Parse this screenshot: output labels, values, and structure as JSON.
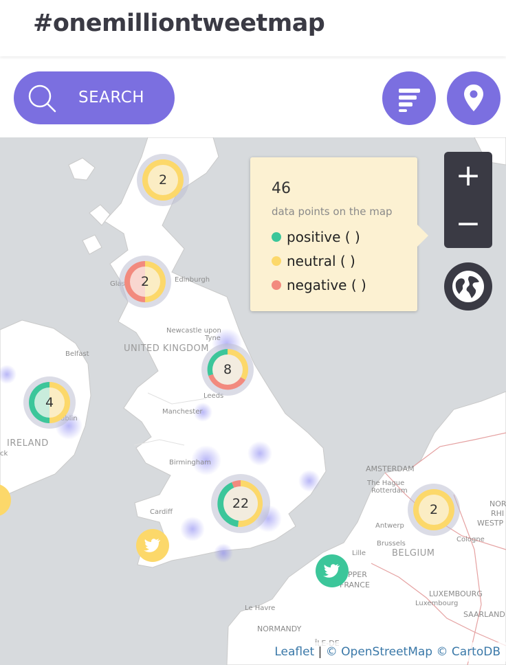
{
  "header": {
    "title": "#onemilliontweetmap"
  },
  "toolbar": {
    "search_label": "SEARCH",
    "search_icon": "search-icon",
    "filter_icon": "bars-icon",
    "location_icon": "location-pin-icon",
    "accent_color": "#7b6fe0"
  },
  "info": {
    "count": "46",
    "subtitle": "data points on the map",
    "legend": [
      {
        "label": "positive ( )",
        "color": "#3cc69a"
      },
      {
        "label": "neutral ( )",
        "color": "#fcd86a"
      },
      {
        "label": "negative ( )",
        "color": "#f28a7e"
      }
    ]
  },
  "zoom": {
    "in_label": "+",
    "out_label": "−"
  },
  "globe_icon": "globe-icon",
  "clusters": [
    {
      "id": "scotland-north",
      "count": "2"
    },
    {
      "id": "glasgow",
      "count": "2"
    },
    {
      "id": "leeds",
      "count": "8"
    },
    {
      "id": "dublin",
      "count": "4"
    },
    {
      "id": "london",
      "count": "22"
    },
    {
      "id": "belgium",
      "count": "2"
    }
  ],
  "places": {
    "edinburgh": "Edinburgh",
    "glasgow": "Glas",
    "newcastle_1": "Newcastle upon",
    "newcastle_2": "Tyne",
    "uk": "UNITED KINGDOM",
    "belfast": "Belfast",
    "leeds": "Leeds",
    "manchester": "Manchester",
    "dublin": "ublin",
    "ireland": "IRELAND",
    "ck": "ck",
    "birmingham": "Birmingham",
    "cardiff": "Cardiff",
    "amsterdam": "AMSTERDAM",
    "the_hague": "The Hague",
    "rotterdam": "Rotterdam",
    "antwerp": "Antwerp",
    "brussels": "Brussels",
    "belgium": "BELGIUM",
    "lille": "Lille",
    "pper": "PPER",
    "france": "FRANCE",
    "cologne": "Cologne",
    "luxembourg": "LUXEMBOURG",
    "luxembourg_city": "Luxembourg",
    "saarland": "SAARLAND",
    "le_havre": "Le Havre",
    "normandy": "NORMANDY",
    "nor": "NOR",
    "rhi": "RHI",
    "westp": "WESTP",
    "ile_de": "ÎLE-DE"
  },
  "attribution": {
    "leaflet": "Leaflet",
    "sep": " | ",
    "osm": "© OpenStreetMap",
    "carto": "© CartoDB"
  },
  "marker_icon": "twitter-bird-icon"
}
